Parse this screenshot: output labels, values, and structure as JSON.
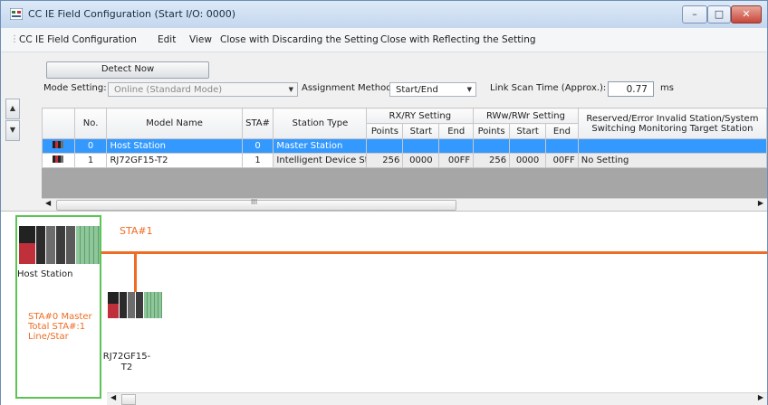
{
  "window": {
    "title": "CC IE Field Configuration (Start I/O: 0000)",
    "controls": {
      "minimize": "–",
      "maximize": "□",
      "close": "✕"
    }
  },
  "menu": [
    "CC IE Field Configuration",
    "Edit",
    "View",
    "Close with Discarding the Setting",
    "Close with Reflecting the Setting"
  ],
  "toolbar": {
    "detect_now": "Detect Now",
    "mode_setting_label": "Mode Setting:",
    "mode_setting_value": "Online (Standard Mode)",
    "assignment_method_label": "Assignment Method:",
    "assignment_method_value": "Start/End",
    "link_scan_label": "Link Scan Time (Approx.):",
    "link_scan_value": "0.77",
    "link_scan_unit": "ms"
  },
  "table": {
    "headers": {
      "no": "No.",
      "model": "Model Name",
      "sta": "STA#",
      "type": "Station Type",
      "rx": "RX/RY Setting",
      "rww": "RWw/RWr Setting",
      "points": "Points",
      "start": "Start",
      "end": "End",
      "reserved_line1": "Reserved/Error Invalid Station/System",
      "reserved_line2": "Switching Monitoring Target Station"
    },
    "rows": [
      {
        "no": "0",
        "model": "Host Station",
        "sta": "0",
        "type": "Master Station",
        "rx_points": "",
        "rx_start": "",
        "rx_end": "",
        "rw_points": "",
        "rw_start": "",
        "rw_end": "",
        "reserved": "",
        "selected": true
      },
      {
        "no": "1",
        "model": "RJ72GF15-T2",
        "sta": "1",
        "type": "Intelligent Device Station",
        "rx_points": "256",
        "rx_start": "0000",
        "rx_end": "00FF",
        "rw_points": "256",
        "rw_start": "0000",
        "rw_end": "00FF",
        "reserved": "No Setting",
        "selected": false
      }
    ],
    "scroll_grip": "III"
  },
  "diagram": {
    "host_label": "Host Station",
    "host_info": [
      "STA#0  Master",
      "Total STA#:1",
      "Line/Star"
    ],
    "sta_label": "STA#1",
    "device_label_line1": "RJ72GF15-",
    "device_label_line2": "T2"
  },
  "colors": {
    "accent_orange": "#ee6c24",
    "selection_blue": "#3399ff",
    "host_border_green": "#5cc456"
  }
}
